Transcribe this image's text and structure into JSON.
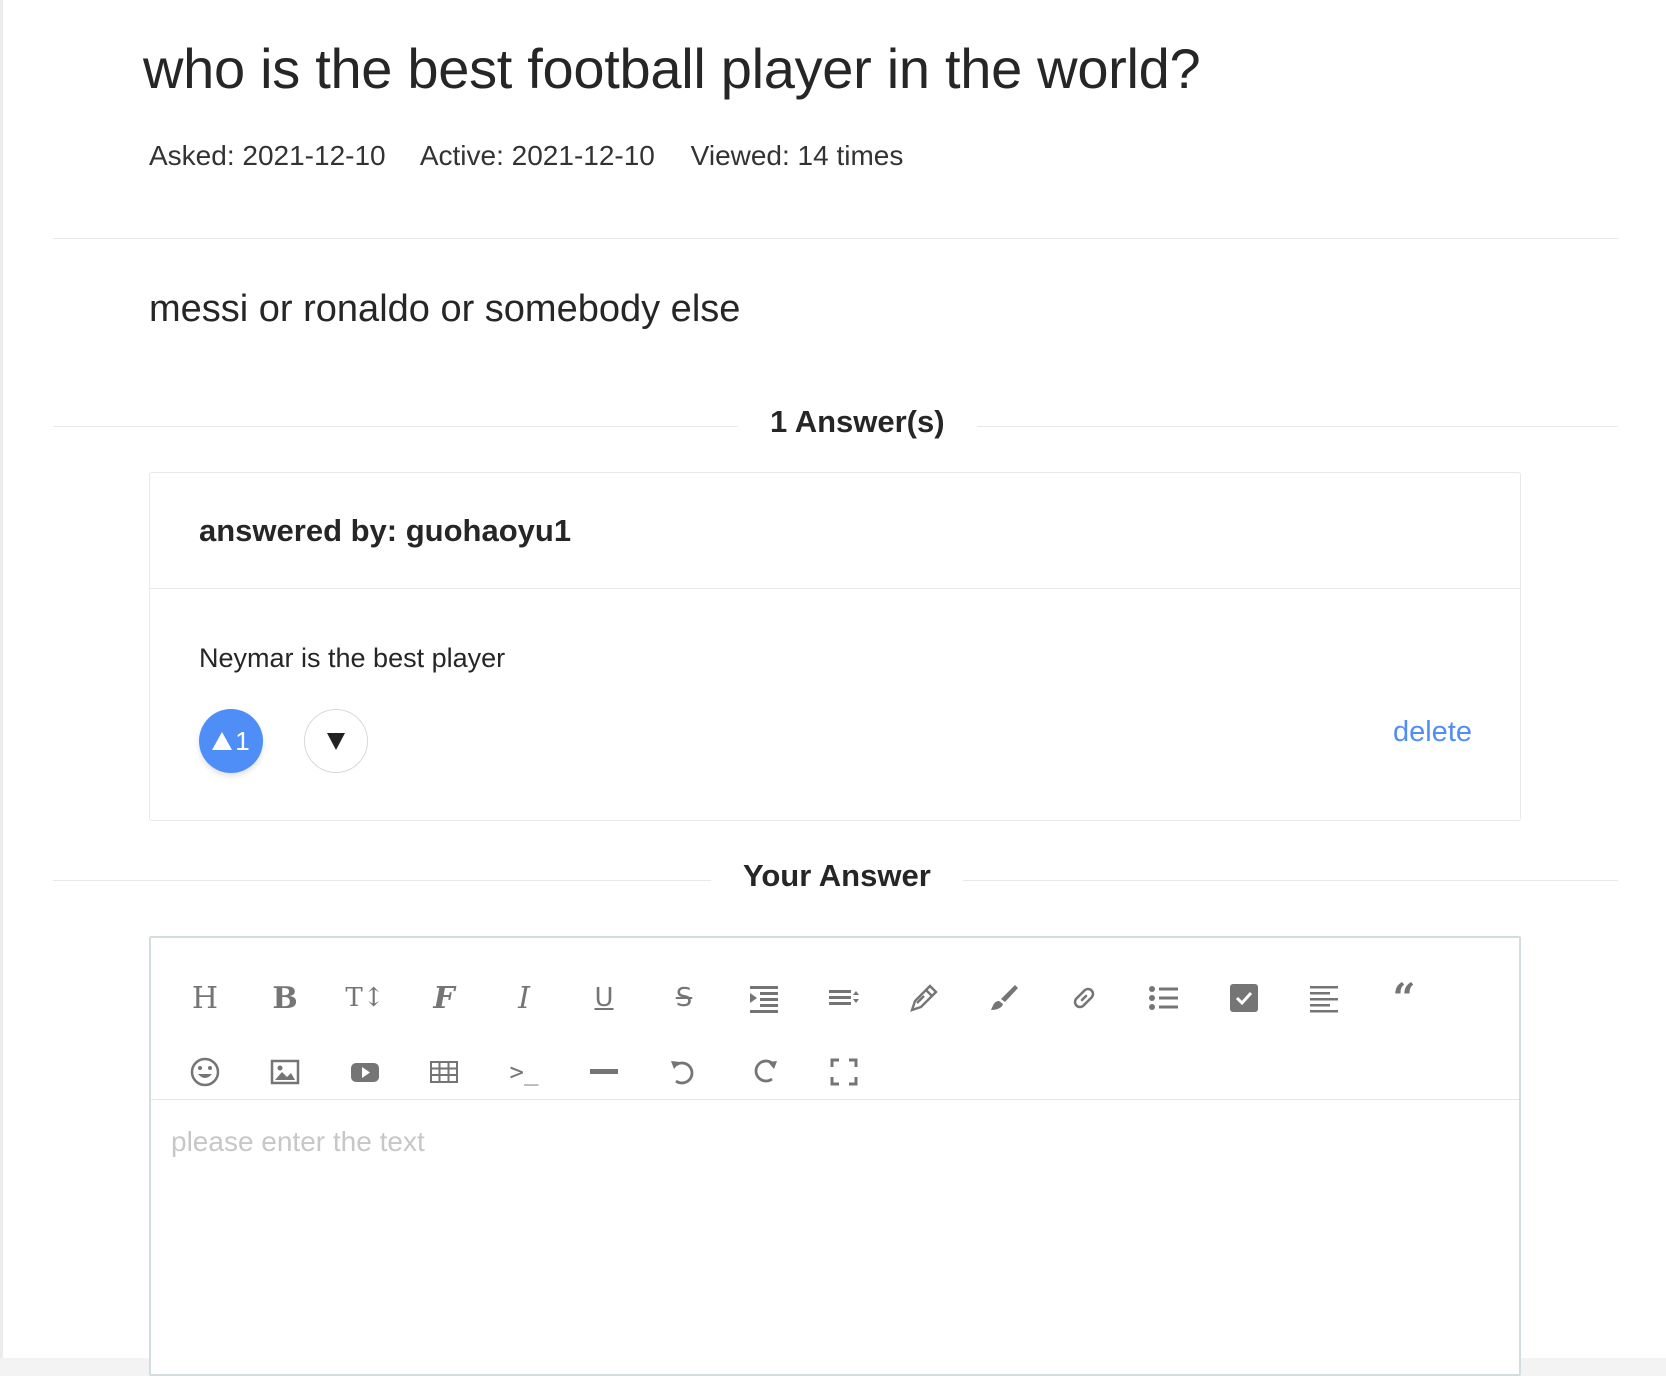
{
  "question": {
    "title": "who is the best football player in the world?",
    "asked": "Asked: 2021-12-10",
    "active": "Active: 2021-12-10",
    "viewed": "Viewed: 14 times",
    "body": "messi or ronaldo or somebody else"
  },
  "answers_header": "1 Answer(s)",
  "answer": {
    "author": "answered by: guohaoyu1",
    "text": "Neymar is the best player",
    "upvotes": "1",
    "delete_label": "delete"
  },
  "your_answer_header": "Your Answer",
  "editor": {
    "placeholder": "please enter the text",
    "toolbar_icons": [
      "heading-icon",
      "bold-icon",
      "font-size-icon",
      "font-family-icon",
      "italic-icon",
      "underline-icon",
      "strikethrough-icon",
      "indent-icon",
      "line-height-icon",
      "pen-icon",
      "brush-icon",
      "link-icon",
      "list-icon",
      "checkbox-icon",
      "align-icon",
      "quote-icon",
      "emoji-icon",
      "image-icon",
      "video-icon",
      "table-icon",
      "code-icon",
      "horizontal-rule-icon",
      "undo-icon",
      "redo-icon",
      "fullscreen-icon"
    ]
  },
  "colors": {
    "accent": "#4f8ef7",
    "text": "#262626",
    "border": "#e8e8e8",
    "icon": "#757575",
    "placeholder": "#c7c7c7"
  }
}
